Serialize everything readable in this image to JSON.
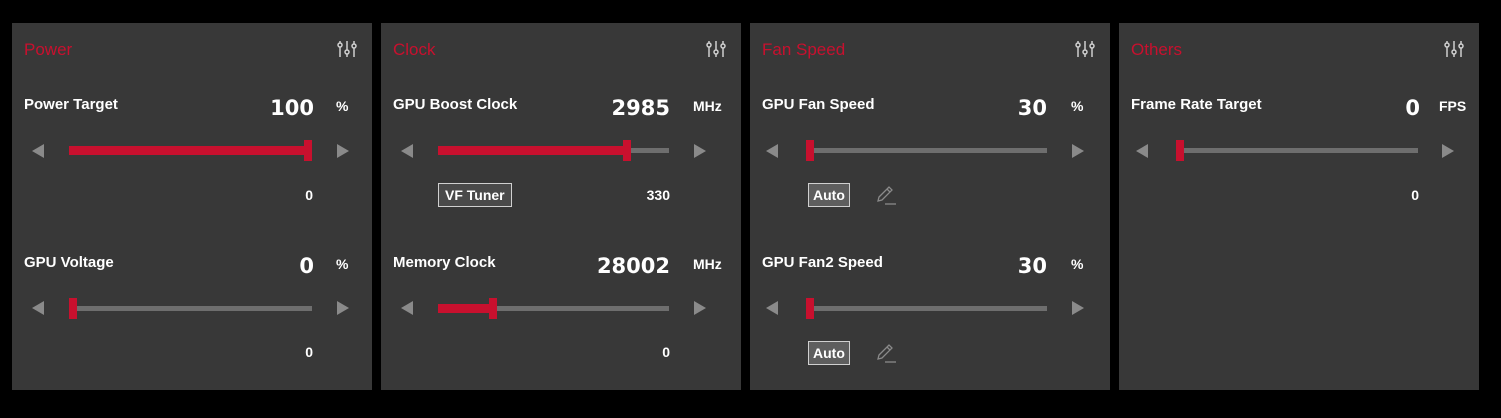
{
  "colors": {
    "accent": "#c8102e",
    "panel_bg": "#383838",
    "track": "#6e6e6e",
    "arrow": "#8a8a8a"
  },
  "panels": [
    {
      "title": "Power",
      "icon": "sliders-icon",
      "controls": [
        {
          "label": "Power Target",
          "value": "100",
          "unit": "%",
          "sub_value": "0",
          "fill_fraction": 1.0
        },
        {
          "label": "GPU Voltage",
          "value": "0",
          "unit": "%",
          "sub_value": "0",
          "fill_fraction": 0.0
        }
      ]
    },
    {
      "title": "Clock",
      "icon": "sliders-icon",
      "controls": [
        {
          "label": "GPU Boost Clock",
          "value": "2985",
          "unit": "MHz",
          "sub_value": "330",
          "button": "VF Tuner",
          "fill_fraction": 0.82
        },
        {
          "label": "Memory Clock",
          "value": "28002",
          "unit": "MHz",
          "sub_value": "0",
          "fill_fraction": 0.24
        }
      ]
    },
    {
      "title": "Fan Speed",
      "icon": "sliders-icon",
      "controls": [
        {
          "label": "GPU Fan Speed",
          "value": "30",
          "unit": "%",
          "button": "Auto",
          "fill_fraction": 0.0
        },
        {
          "label": "GPU Fan2 Speed",
          "value": "30",
          "unit": "%",
          "button": "Auto",
          "fill_fraction": 0.0
        }
      ]
    },
    {
      "title": "Others",
      "icon": "sliders-icon",
      "controls": [
        {
          "label": "Frame Rate Target",
          "value": "0",
          "unit": "FPS",
          "sub_value": "0",
          "fill_fraction": 0.0
        }
      ]
    }
  ]
}
